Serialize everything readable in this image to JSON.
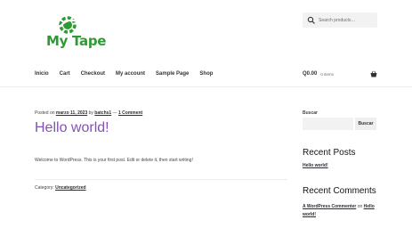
{
  "header": {
    "logo_text": "My Tape",
    "search_placeholder": "Search products…"
  },
  "nav": {
    "items": [
      "Inicio",
      "Cart",
      "Checkout",
      "My account",
      "Sample Page",
      "Shop"
    ]
  },
  "cart": {
    "amount": "Q0.00",
    "count": "0 items"
  },
  "post": {
    "posted_on_label": "Posted on",
    "date": "marzo 11, 2023",
    "by_label": "by",
    "author": "batchs1",
    "separator": "—",
    "comments": "1 Comment",
    "title": "Hello world!",
    "body": "Welcome to WordPress. This is your first post. Edit or delete it, then start writing!",
    "category_label": "Category:",
    "category": "Uncategorized"
  },
  "sidebar": {
    "search_label": "Buscar",
    "search_button": "Buscar",
    "recent_posts_title": "Recent Posts",
    "recent_post_link": "Hello world!",
    "recent_comments_title": "Recent Comments",
    "comment_author": "A WordPress Commenter",
    "comment_on": "on",
    "comment_post": "Hello world!"
  },
  "colors": {
    "brand_green": "#2f9a35",
    "title_purple": "#7f54b3"
  }
}
